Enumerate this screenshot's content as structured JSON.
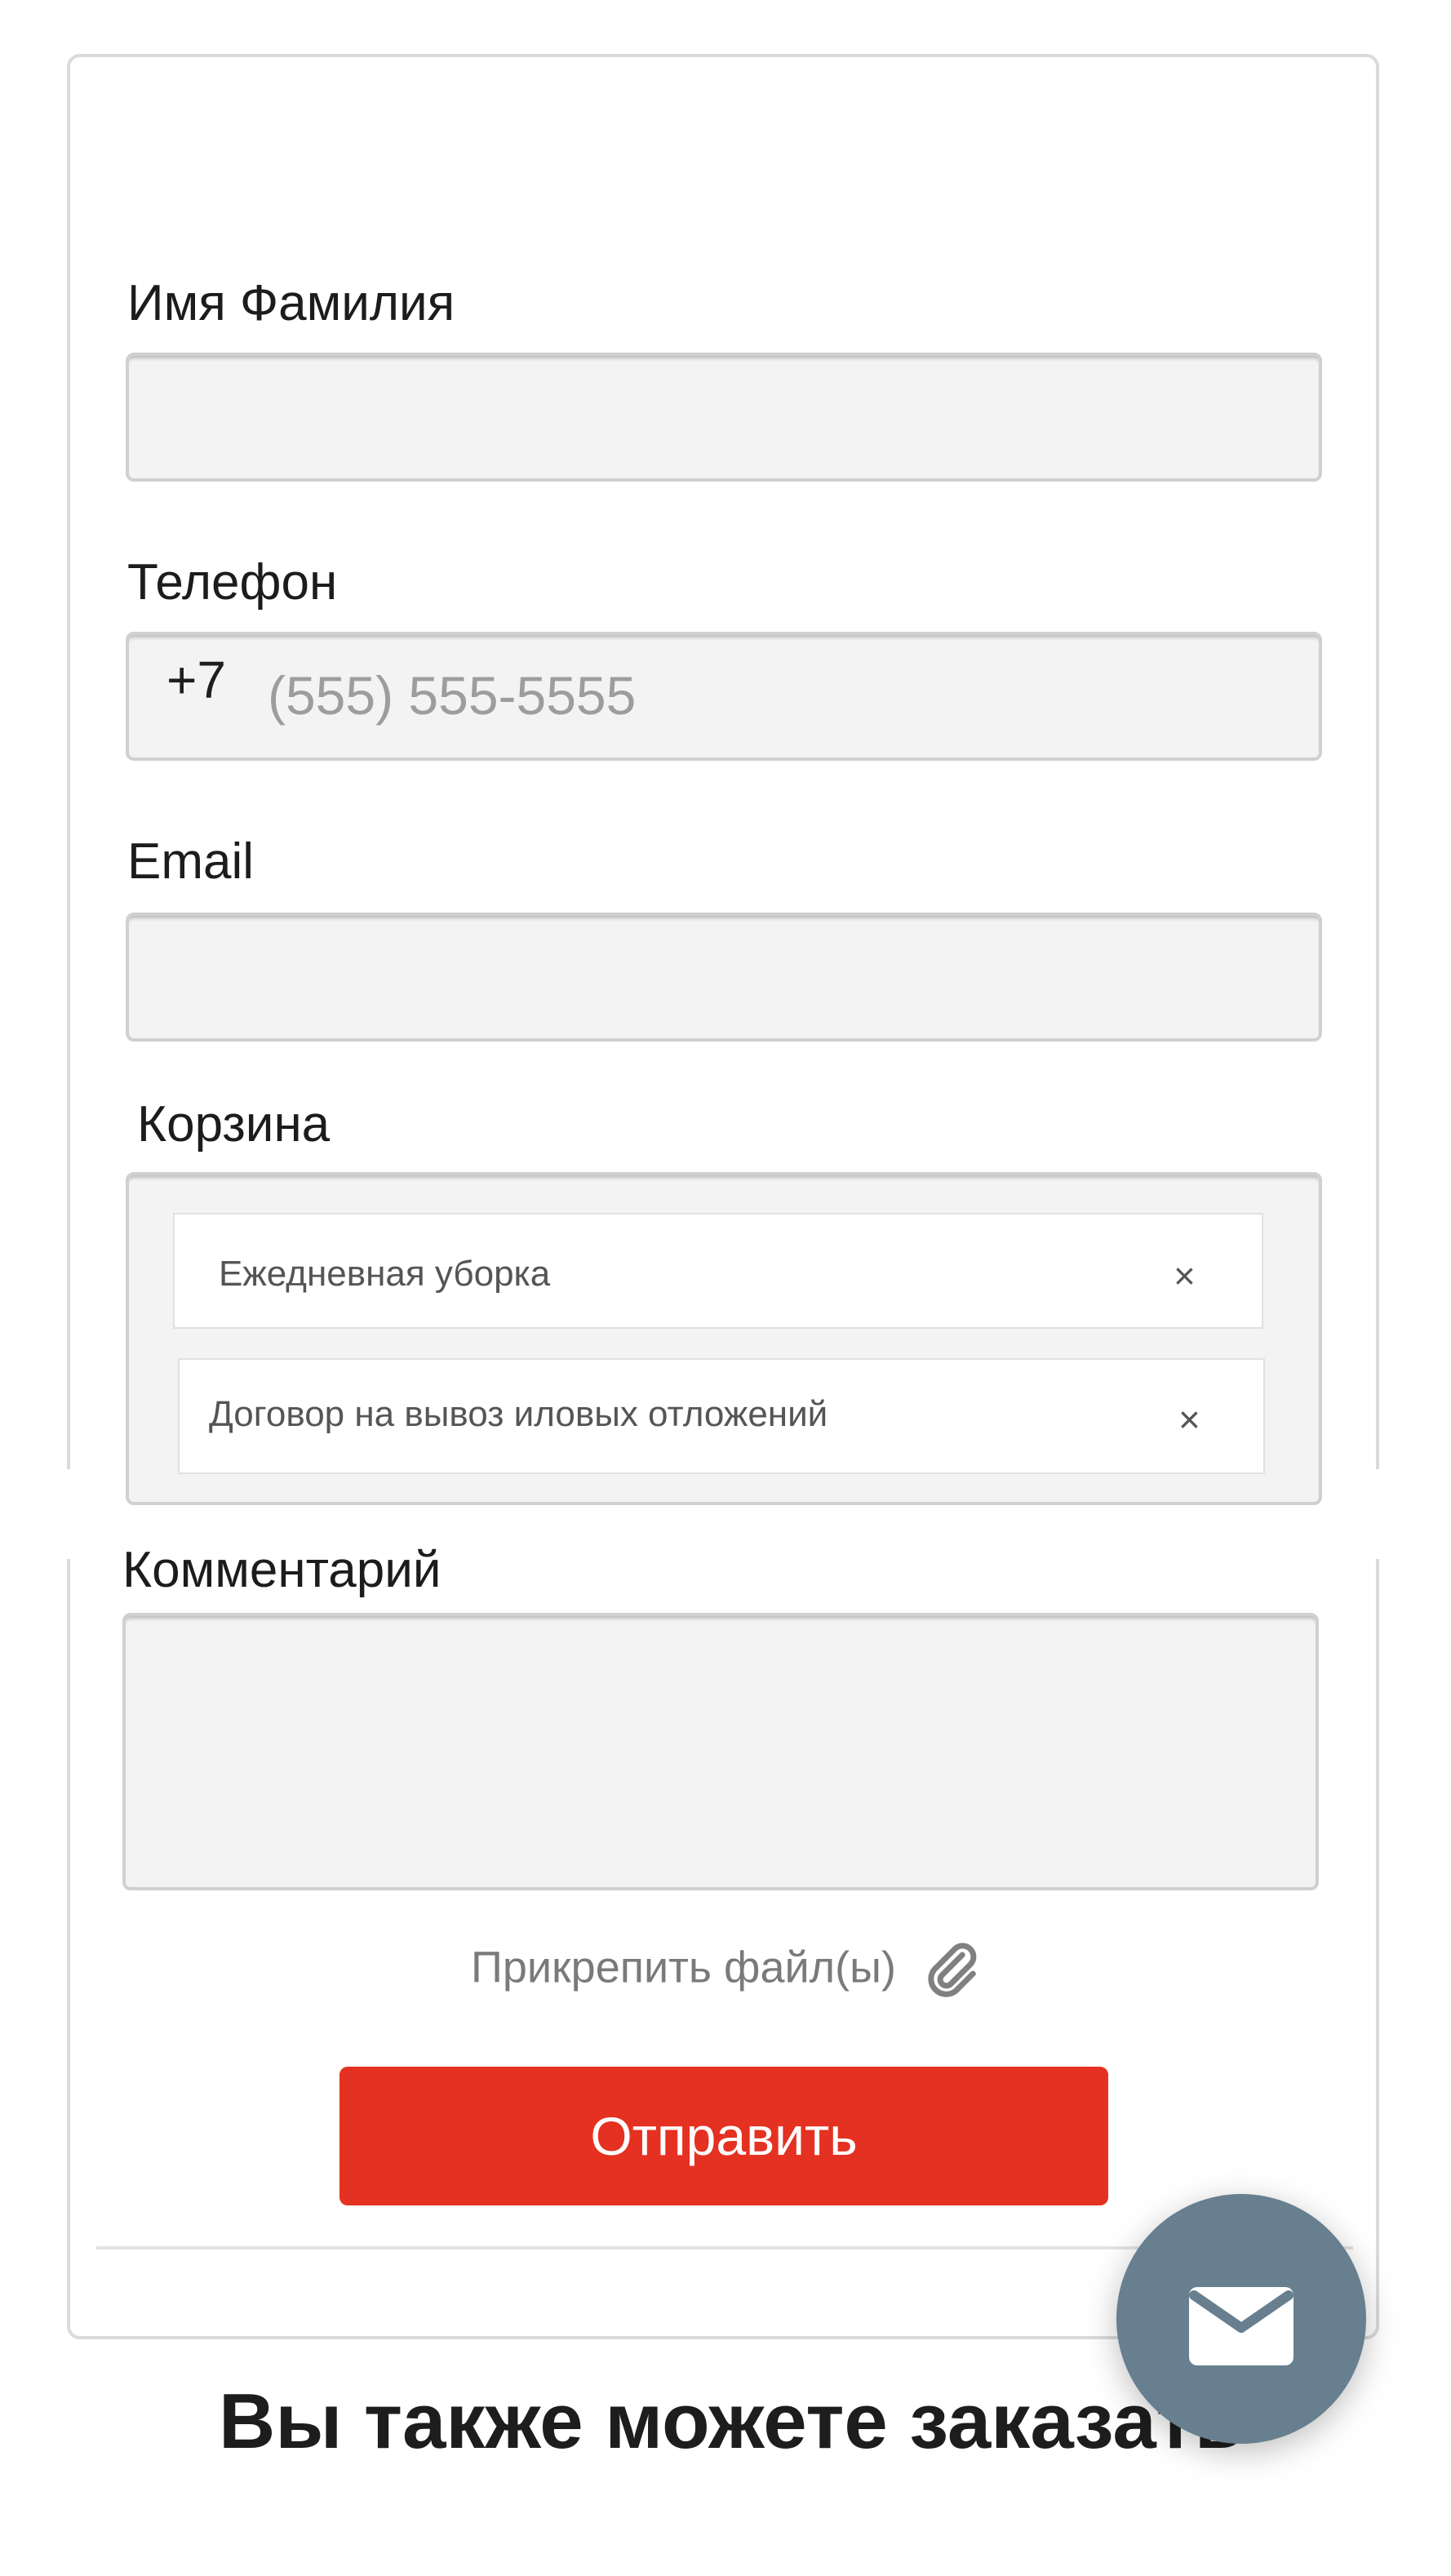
{
  "form": {
    "name_label": "Имя Фамилия",
    "name_value": "",
    "phone_label": "Телефон",
    "phone_prefix": "+7",
    "phone_placeholder": "(555) 555-5555",
    "email_label": "Email",
    "email_value": "",
    "cart_label": "Корзина",
    "cart_items": [
      {
        "label": "Ежедневная уборка",
        "remove": "×"
      },
      {
        "label": "Договор на вывоз иловых отложений",
        "remove": "×"
      }
    ],
    "comment_label": "Комментарий",
    "comment_value": "",
    "attach_label": "Прикрепить файл(ы)",
    "submit_label": "Отправить"
  },
  "section": {
    "heading": "Вы также можете заказать"
  },
  "fab": {
    "icon": "envelope-icon"
  },
  "colors": {
    "accent": "#e53121",
    "fab": "#677f8f",
    "field_bg": "#f3f3f3"
  }
}
